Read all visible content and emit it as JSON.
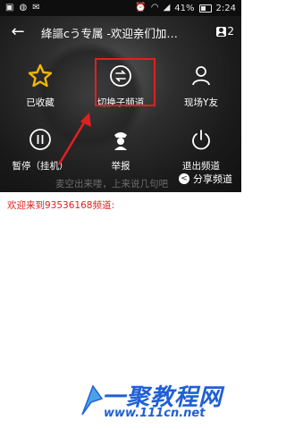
{
  "status_bar": {
    "battery": "41%",
    "time": "2:24"
  },
  "header": {
    "title": "絳謳cう专属 -欢迎亲们加…",
    "member_count": "2"
  },
  "menu": {
    "items": [
      {
        "label": "已收藏",
        "icon": "star-icon"
      },
      {
        "label": "切换子频道",
        "icon": "switch-icon"
      },
      {
        "label": "现场Y友",
        "icon": "user-icon"
      },
      {
        "label": "暂停（挂机）",
        "icon": "pause-icon"
      },
      {
        "label": "举报",
        "icon": "police-icon"
      },
      {
        "label": "退出频道",
        "icon": "power-icon"
      }
    ],
    "share_label": "分享频道"
  },
  "background_text": "麦空出来喽，上来说几句吧",
  "welcome_text": "欢迎来到93536168频道:",
  "watermark": {
    "title": "一聚教程网",
    "url": "www.111cn.net"
  },
  "colors": {
    "highlight": "#e02020",
    "welcome": "#e0201f",
    "watermark": "#1f5fd6"
  }
}
